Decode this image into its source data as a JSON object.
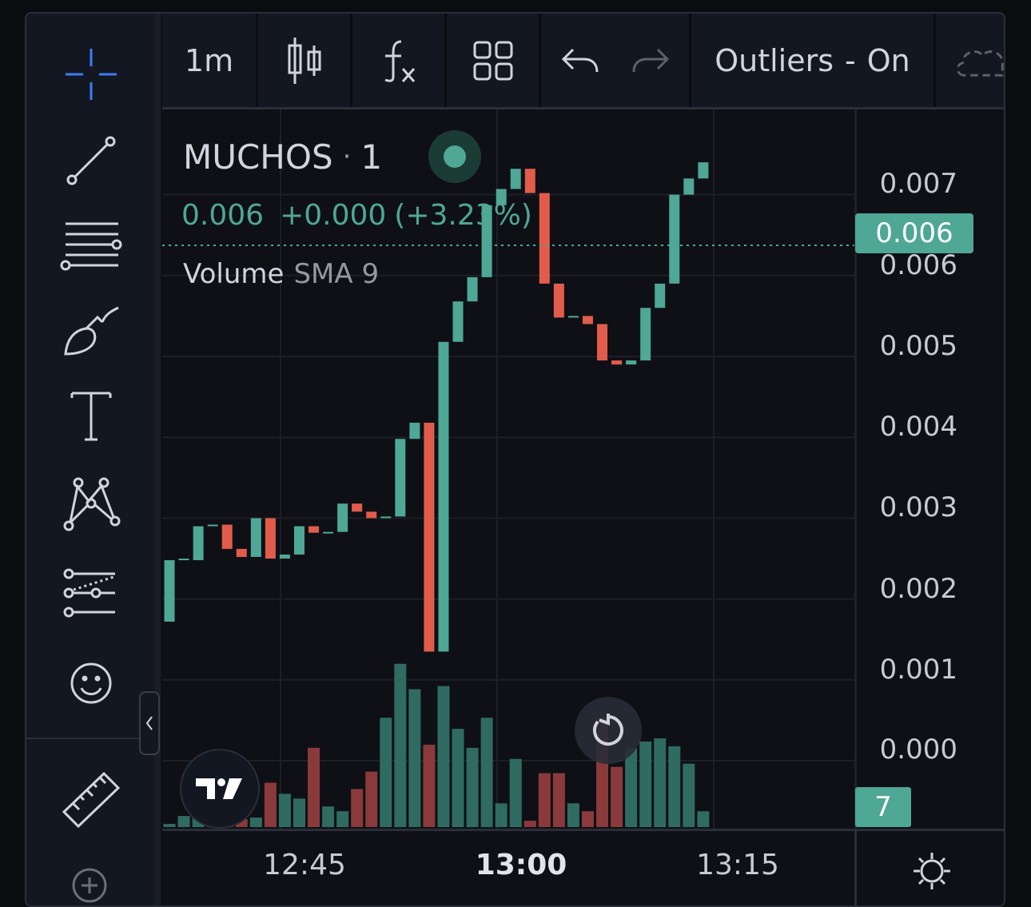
{
  "toolbar": {
    "interval": "1m",
    "outliers_label": "Outliers",
    "outliers_sep": "-",
    "outliers_state": "On"
  },
  "sidebar": {
    "tools": [
      "crosshair-icon",
      "trend-line-icon",
      "fib-retracement-icon",
      "brush-icon",
      "text-icon",
      "pattern-icon",
      "prediction-icon",
      "emoji-icon",
      "ruler-icon",
      "zoom-in-icon"
    ]
  },
  "legend": {
    "symbol": "MUCHOS",
    "separator": "·",
    "interval": "1",
    "price": "0.006",
    "change": "+0.000",
    "change_pct": "(+3.23%)",
    "study": "Volume",
    "study_params": "SMA 9"
  },
  "price_axis": {
    "ticks": [
      "0.007",
      "0.006",
      "0.005",
      "0.004",
      "0.003",
      "0.002",
      "0.001",
      "0.000"
    ],
    "last_price_label": "0.006",
    "volume_label": "7"
  },
  "time_axis": {
    "labels": [
      "12:45",
      "13:00",
      "13:15"
    ]
  },
  "colors": {
    "up": "#4fa796",
    "down": "#e25c4b",
    "vol_up": "#2f6b60",
    "vol_down": "#8a3a3a",
    "price_line": "#4fa796",
    "background": "#0e1016"
  },
  "chart_data": {
    "type": "candlestick",
    "x_unit": "minute",
    "x_start": "12:45",
    "y_range": [
      0.0,
      0.0075
    ],
    "candles": [
      {
        "o": 0.00172,
        "c": 0.00248,
        "v": 0.2
      },
      {
        "o": 0.00248,
        "c": 0.0025,
        "v": 0.7
      },
      {
        "o": 0.00248,
        "c": 0.0029,
        "v": 1.0
      },
      {
        "o": 0.0029,
        "c": 0.00292,
        "v": 0.8
      },
      {
        "o": 0.00292,
        "c": 0.00262,
        "v": 0.7
      },
      {
        "o": 0.00262,
        "c": 0.00252,
        "v": 0.5
      },
      {
        "o": 0.00252,
        "c": 0.003,
        "v": 0.6
      },
      {
        "o": 0.003,
        "c": 0.0025,
        "v": 2.8
      },
      {
        "o": 0.0025,
        "c": 0.00255,
        "v": 2.1
      },
      {
        "o": 0.00255,
        "c": 0.0029,
        "v": 1.8
      },
      {
        "o": 0.0029,
        "c": 0.00282,
        "v": 5.0
      },
      {
        "o": 0.00282,
        "c": 0.00283,
        "v": 1.3
      },
      {
        "o": 0.00283,
        "c": 0.00318,
        "v": 1.0
      },
      {
        "o": 0.00318,
        "c": 0.00308,
        "v": 2.4
      },
      {
        "o": 0.00308,
        "c": 0.003,
        "v": 3.5
      },
      {
        "o": 0.003,
        "c": 0.00302,
        "v": 6.9
      },
      {
        "o": 0.00302,
        "c": 0.00398,
        "v": 10.3
      },
      {
        "o": 0.00398,
        "c": 0.00418,
        "v": 8.7
      },
      {
        "o": 0.00418,
        "c": 0.00135,
        "v": 5.2
      },
      {
        "o": 0.00135,
        "c": 0.00518,
        "v": 8.9
      },
      {
        "o": 0.00518,
        "c": 0.00568,
        "v": 6.2
      },
      {
        "o": 0.00568,
        "c": 0.00598,
        "v": 5.0
      },
      {
        "o": 0.00598,
        "c": 0.00687,
        "v": 6.9
      },
      {
        "o": 0.00687,
        "c": 0.00707,
        "v": 1.5
      },
      {
        "o": 0.00707,
        "c": 0.00732,
        "v": 4.3
      },
      {
        "o": 0.00732,
        "c": 0.00702,
        "v": 0.4
      },
      {
        "o": 0.00702,
        "c": 0.0059,
        "v": 3.4
      },
      {
        "o": 0.0059,
        "c": 0.00548,
        "v": 3.4
      },
      {
        "o": 0.00548,
        "c": 0.0055,
        "v": 1.5
      },
      {
        "o": 0.0055,
        "c": 0.0054,
        "v": 1.0
      },
      {
        "o": 0.0054,
        "c": 0.00495,
        "v": 6.9
      },
      {
        "o": 0.00495,
        "c": 0.0049,
        "v": 3.8
      },
      {
        "o": 0.0049,
        "c": 0.00495,
        "v": 5.0
      },
      {
        "o": 0.00495,
        "c": 0.0056,
        "v": 5.4
      },
      {
        "o": 0.0056,
        "c": 0.0059,
        "v": 5.6
      },
      {
        "o": 0.0059,
        "c": 0.007,
        "v": 5.1
      },
      {
        "o": 0.007,
        "c": 0.0072,
        "v": 4.0
      },
      {
        "o": 0.0072,
        "c": 0.0074,
        "v": 1.0
      }
    ],
    "volume_max": 12
  }
}
